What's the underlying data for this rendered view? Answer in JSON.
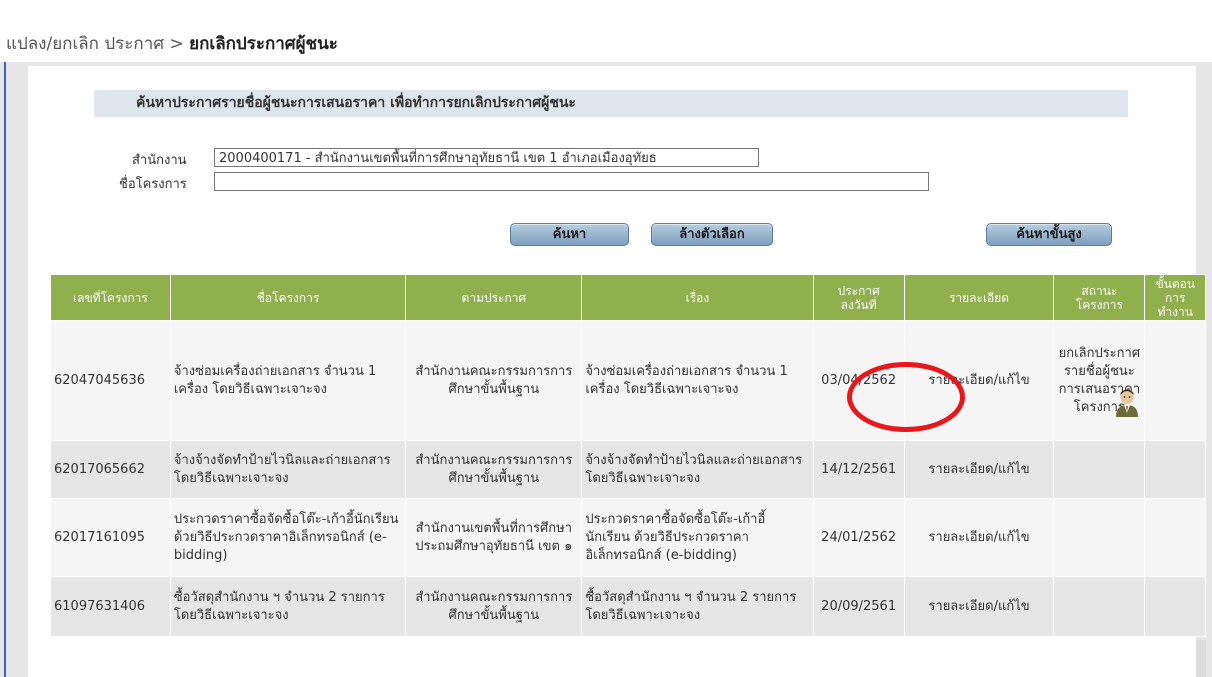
{
  "breadcrumb": {
    "prefix": "แปลง/ยกเลิก ประกาศ",
    "separator": ">",
    "current": "ยกเลิกประกาศผู้ชนะ"
  },
  "search": {
    "header": "ค้นหาประกาศรายชื่อผู้ชนะการเสนอราคา เพื่อทำการยกเลิกประกาศผู้ชนะ",
    "agency_label": "สำนักงาน",
    "agency_value": "2000400171 - สำนักงานเขตพื้นที่การศึกษาอุทัยธานี เขต 1 อำเภอเมืองอุทัยธ",
    "project_label": "ชื่อโครงการ",
    "project_value": ""
  },
  "buttons": {
    "search": "ค้นหา",
    "clear": "ล้างตัวเลือก",
    "advanced": "ค้นหาขั้นสูง"
  },
  "table": {
    "headers": {
      "project_no": "เลขที่โครงการ",
      "project_name": "ชื่อโครงการ",
      "issued_by": "ตามประกาศ",
      "subject": "เรื่อง",
      "announce_date_1": "ประกาศ",
      "announce_date_2": "ลงวันที่",
      "detail": "รายละเอียด",
      "status_1": "สถานะ",
      "status_2": "โครงการ",
      "step_1": "ขั้นตอน",
      "step_2": "การ",
      "step_3": "ทำงาน"
    },
    "rows": [
      {
        "project_no": "62047045636",
        "project_name": "จ้างซ่อมเครื่องถ่ายเอกสาร จำนวน 1 เครื่อง โดยวิธีเฉพาะเจาะจง",
        "issued_by": "สำนักงานคณะกรรมการการศึกษาขั้นพื้นฐาน",
        "subject": "จ้างซ่อมเครื่องถ่ายเอกสาร จำนวน 1 เครื่อง โดยวิธีเฉพาะเจาะจง",
        "date": "03/04/2562",
        "detail": "รายละเอียด/แก้ไข",
        "status": "ยกเลิกประกาศรายชื่อผู้ชนะการเสนอราคาโครงการ"
      },
      {
        "project_no": "62017065662",
        "project_name": "จ้างจ้างจัดทำป้ายไวนิลและถ่ายเอกสาร โดยวิธีเฉพาะเจาะจง",
        "issued_by": "สำนักงานคณะกรรมการการศึกษาขั้นพื้นฐาน",
        "subject": "จ้างจ้างจัดทำป้ายไวนิลและถ่ายเอกสาร โดยวิธีเฉพาะเจาะจง",
        "date": "14/12/2561",
        "detail": "รายละเอียด/แก้ไข",
        "status": ""
      },
      {
        "project_no": "62017161095",
        "project_name": "ประกวดราคาซื้อจัดซื้อโต๊ะ-เก้าอี้นักเรียน ด้วยวิธีประกวดราคาอิเล็กทรอนิกส์ (e-bidding)",
        "issued_by": "สำนักงานเขตพื้นที่การศึกษาประถมศึกษาอุทัยธานี เขต ๑",
        "subject": "ประกวดราคาซื้อจัดซื้อโต๊ะ-เก้าอี้นักเรียน ด้วยวิธีประกวดราคาอิเล็กทรอนิกส์ (e-bidding)",
        "date": "24/01/2562",
        "detail": "รายละเอียด/แก้ไข",
        "status": ""
      },
      {
        "project_no": "61097631406",
        "project_name": "ซื้อวัสดุสำนักงาน ฯ จำนวน 2 รายการ โดยวิธีเฉพาะเจาะจง",
        "issued_by": "สำนักงานคณะกรรมการการศึกษาขั้นพื้นฐาน",
        "subject": "ซื้อวัสดุสำนักงาน ฯ จำนวน 2 รายการ โดยวิธีเฉพาะเจาะจง",
        "date": "20/09/2561",
        "detail": "รายละเอียด/แก้ไข",
        "status": ""
      }
    ]
  },
  "icons": {
    "step": "officer-icon"
  },
  "colors": {
    "header_bg": "#8fb04c",
    "link": "#6b8fc7",
    "annotation": "#e8171b",
    "section_bg": "#dfe5ed"
  }
}
